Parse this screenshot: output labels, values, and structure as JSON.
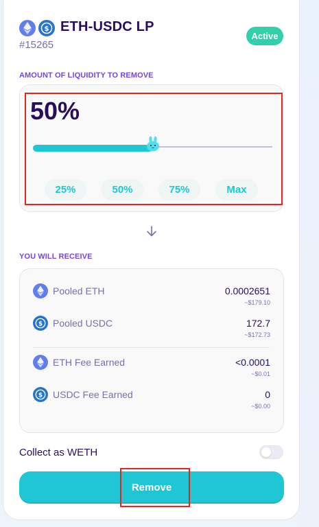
{
  "position": {
    "pair": "ETH-USDC LP",
    "token_id": "#15265",
    "status": "Active"
  },
  "remove": {
    "section_label": "AMOUNT OF LIQUIDITY TO REMOVE",
    "percent_display": "50%",
    "slider_value_percent": 50,
    "presets": [
      "25%",
      "50%",
      "75%",
      "Max"
    ]
  },
  "receive": {
    "section_label": "YOU WILL RECEIVE",
    "rows": [
      {
        "icon": "eth-icon",
        "label": "Pooled ETH",
        "value": "0.0002651",
        "usd": "~$179.10"
      },
      {
        "icon": "usdc-icon",
        "label": "Pooled USDC",
        "value": "172.7",
        "usd": "~$172.73"
      },
      {
        "icon": "eth-icon",
        "label": "ETH Fee Earned",
        "value": "<0.0001",
        "usd": "~$0.01"
      },
      {
        "icon": "usdc-icon",
        "label": "USDC Fee Earned",
        "value": "0",
        "usd": "~$0.00"
      }
    ]
  },
  "collect_weth": {
    "label": "Collect as WETH",
    "enabled": false
  },
  "action": {
    "remove_label": "Remove"
  },
  "colors": {
    "primary": "#1fc7d4",
    "text": "#280d5f",
    "secondary": "#7645d9",
    "success": "#31d0aa",
    "highlight": "#e0261f"
  }
}
